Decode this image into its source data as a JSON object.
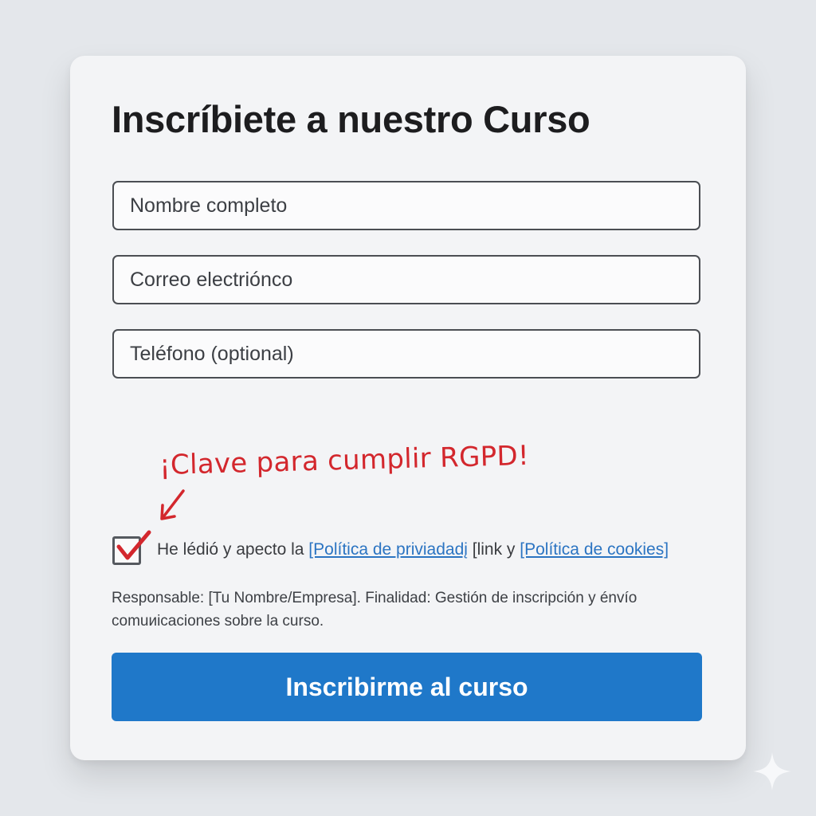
{
  "form": {
    "title": "Inscríbiete a nuestro Curso",
    "fields": [
      {
        "placeholder": "Nombre completo"
      },
      {
        "placeholder": "Correo electrióncο"
      },
      {
        "placeholder": "Teléfono (optional)"
      }
    ],
    "annotation": "¡Clave para cumplir RGPD!",
    "consent": {
      "checked": true,
      "text_before": "He lédió y apecto la ",
      "privacy_link": "[Política de priviadadį",
      "text_middle": " [link y ",
      "cookies_link": "[Política de cookies]"
    },
    "legal_text": "Responsable: [Tu Nombre/Empresa]. Finalidad: Gestión de inscripción y énvío comuиicaciones sobre la curso.",
    "submit_label": "Inscribirme al curso"
  },
  "colors": {
    "accent": "#1f78c9",
    "annotation": "#d3272d",
    "link": "#2b74c2",
    "background": "#e4e7eb",
    "card": "#f3f4f6"
  },
  "icons": {
    "checkbox_mark": "checkmark-icon",
    "annotation_arrow": "arrow-down-left-icon",
    "corner": "sparkle-icon"
  }
}
